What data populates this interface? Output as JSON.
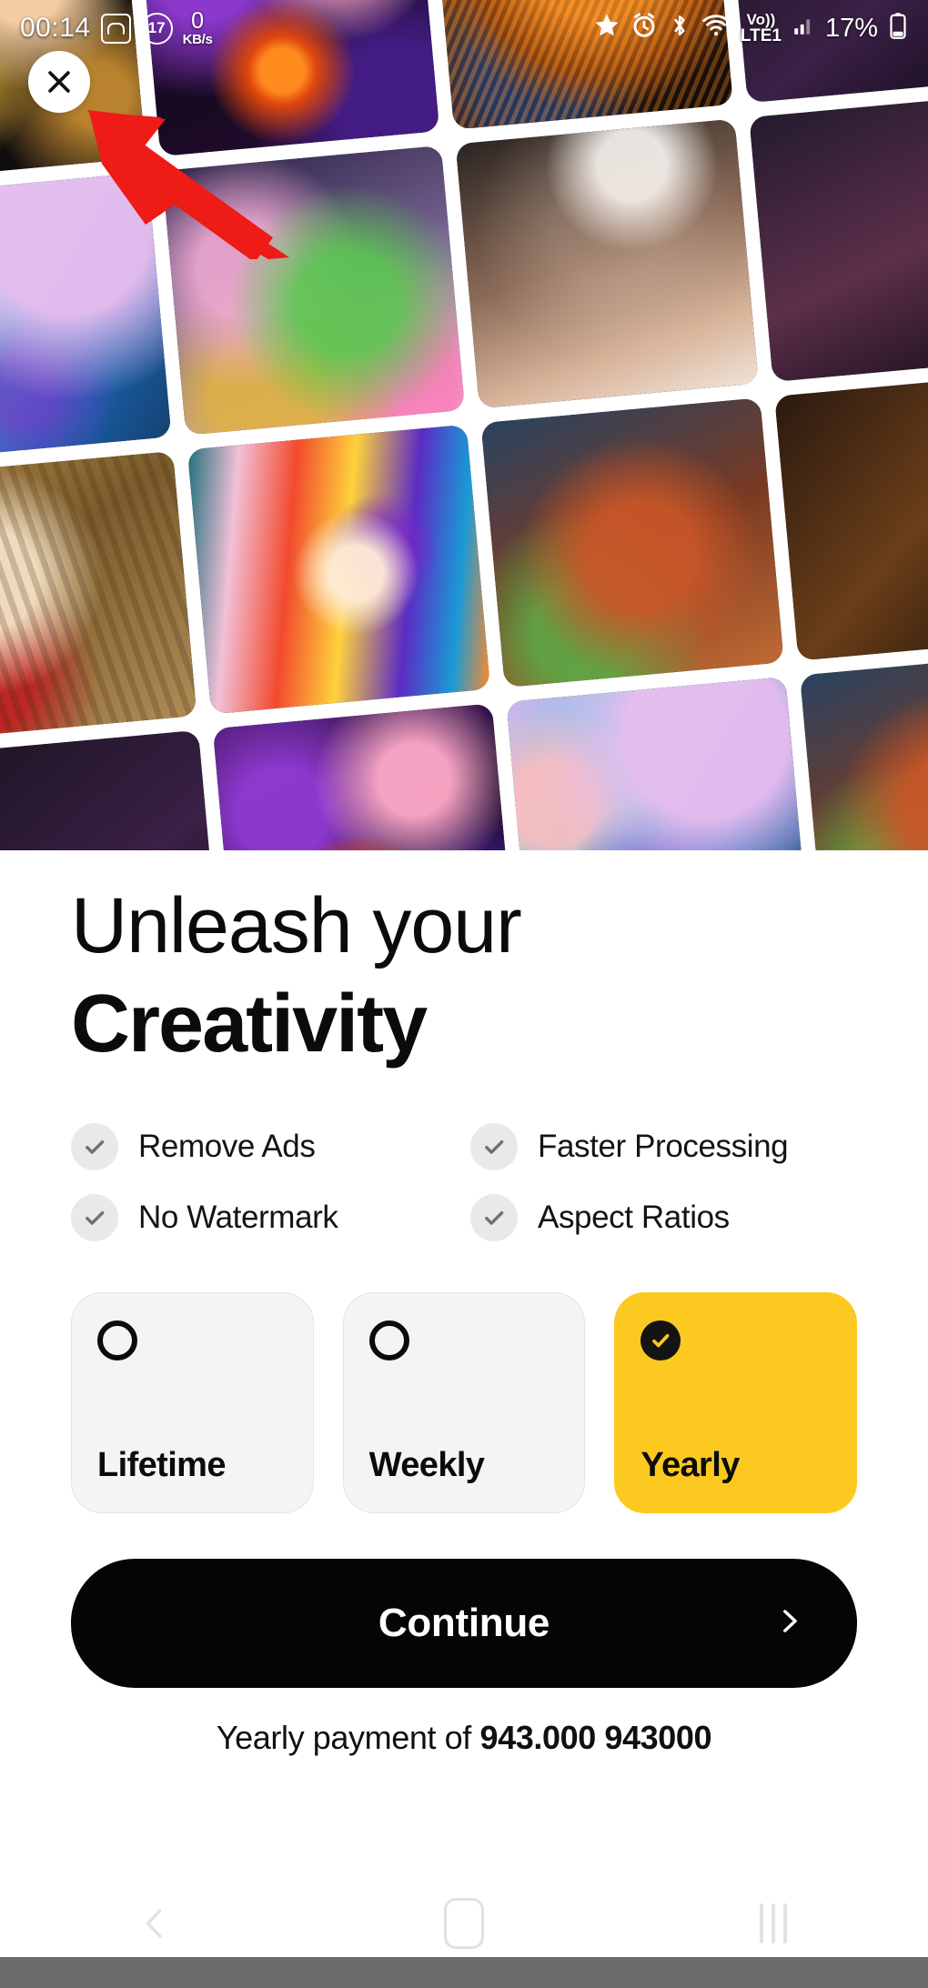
{
  "statusbar": {
    "clock": "00:14",
    "screenshot_icon": "screenshot-icon",
    "notification_count": "17",
    "netspeed_value": "0",
    "netspeed_unit": "KB/s",
    "star_icon": "star-icon",
    "alarm_icon": "alarm-icon",
    "bluetooth_icon": "bluetooth-icon",
    "wifi_icon": "wifi-icon",
    "volte_top": "Vo))",
    "volte_bottom": "LTE1",
    "signal_icon": "signal-bars-icon",
    "battery_percent": "17%",
    "battery_icon": "battery-icon"
  },
  "close_button": {
    "icon": "close-icon",
    "label": "Close"
  },
  "annotation": {
    "arrow": "red-arrow-pointing-to-close-button"
  },
  "collage": {
    "tiles": [
      "cyborg-woman-with-gold-coins",
      "psychedelic-mandala-face",
      "ornate-fox-portrait",
      "dark-abstract",
      "blue-haired-woman-portrait",
      "pink-luxury-interior-with-palm",
      "man-in-snow-portrait",
      "dark-abstract-2",
      "regal-cat-in-red-uniform",
      "anime-boy-with-goggles-neon",
      "isometric-temple-house",
      "dark-abstract-3"
    ]
  },
  "headline": {
    "line1": "Unleash your",
    "line2": "Creativity"
  },
  "features": [
    {
      "label": "Remove Ads",
      "icon": "check-icon"
    },
    {
      "label": "Faster Processing",
      "icon": "check-icon"
    },
    {
      "label": "No Watermark",
      "icon": "check-icon"
    },
    {
      "label": "Aspect Ratios",
      "icon": "check-icon"
    }
  ],
  "plans": [
    {
      "label": "Lifetime",
      "selected": false,
      "radio_icon": "radio-unchecked-icon"
    },
    {
      "label": "Weekly",
      "selected": false,
      "radio_icon": "radio-unchecked-icon"
    },
    {
      "label": "Yearly",
      "selected": true,
      "radio_icon": "radio-checked-icon"
    }
  ],
  "cta": {
    "label": "Continue",
    "chevron_icon": "chevron-right-icon"
  },
  "payment_note": {
    "prefix": "Yearly payment of ",
    "amount": "943.000 943000"
  },
  "navbar": {
    "back": "back-icon",
    "home": "home-icon",
    "recents": "recents-icon"
  },
  "colors": {
    "accent_yellow": "#fbc91f",
    "cta_black": "#050505",
    "card_gray": "#f3f4f6",
    "check_bg": "#e9e9ec",
    "bottom_bar": "#6b6b6b",
    "arrow_red": "#ee1b16"
  }
}
